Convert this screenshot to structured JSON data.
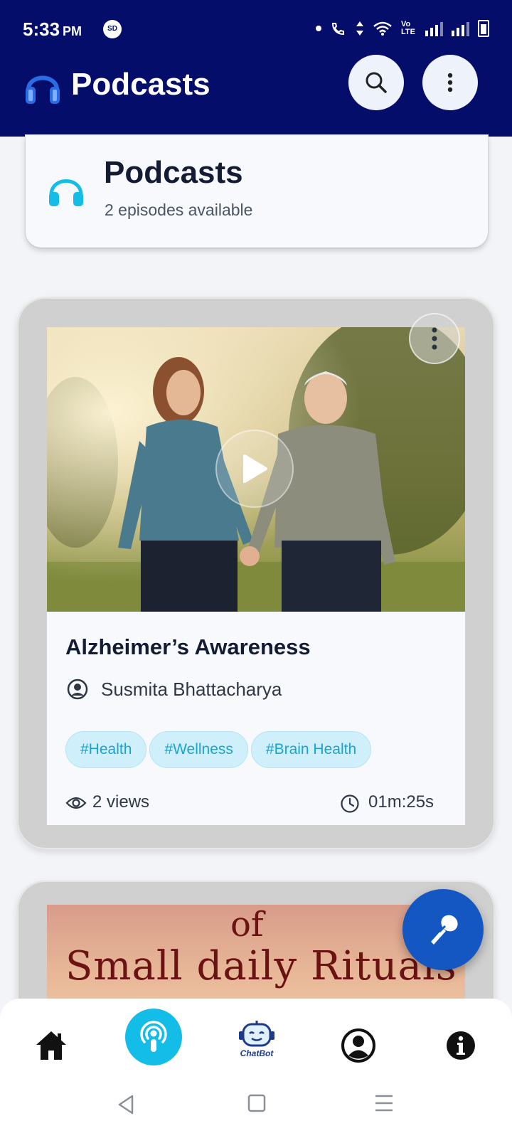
{
  "status_bar": {
    "time": "5:33",
    "ampm": "PM",
    "sd_badge": "SD",
    "network_label": "Vo LTE"
  },
  "app_bar": {
    "title": "Podcasts",
    "icons": [
      "headphones-icon",
      "search-icon",
      "more-vert-icon"
    ]
  },
  "header_card": {
    "title": "Podcasts",
    "subtitle": "2 episodes available"
  },
  "episodes": [
    {
      "title": "Alzheimer’s Awareness",
      "author": "Susmita Bhattacharya",
      "tags": [
        "#Health",
        "#Wellness",
        "#Brain Health"
      ],
      "views": "2 views",
      "duration": "01m:25s"
    },
    {
      "thumbnail_text_line1": "of",
      "thumbnail_text_line2": "Small daily Rituals"
    }
  ],
  "bottom_nav": {
    "items": [
      "home-icon",
      "podcast-icon",
      "chatbot-icon",
      "profile-icon",
      "info-icon"
    ],
    "chatbot_label": "ChatBot"
  },
  "colors": {
    "app_bar": "#050d6b",
    "accent": "#14bde8",
    "fab": "#1457c2",
    "tag_bg": "#cfeffa",
    "tag_text": "#1aa3cf"
  }
}
